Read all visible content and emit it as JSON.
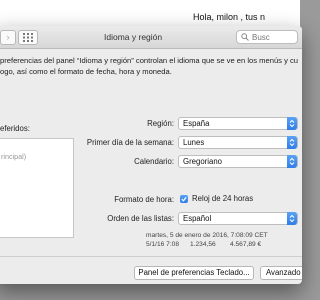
{
  "background": {
    "greeting": "Hola,  milon ,  tus n"
  },
  "window": {
    "title": "Idioma y región",
    "search_placeholder": "Busc"
  },
  "description": [
    "preferencias del panel “Idioma y región” controlan el idioma que se ve en los menús y cu",
    "ogo, así como el formato de fecha, hora y moneda."
  ],
  "languages": {
    "label": "eferidos:",
    "items": [
      "rincipal)"
    ]
  },
  "settings": {
    "region_label": "Región:",
    "region_value": "España",
    "first_day_label": "Primer día de la semana:",
    "first_day_value": "Lunes",
    "calendar_label": "Calendario:",
    "calendar_value": "Gregoriano",
    "time_format_label": "Formato de hora:",
    "time_format_checkbox_label": "Reloj de 24 horas",
    "sort_order_label": "Orden de las listas:",
    "sort_order_value": "Español"
  },
  "samples": {
    "line1": "martes, 5 de enero de 2016, 7:08:09 CET",
    "date_short": "5/1/16 7:08",
    "number": "1.234,56",
    "currency": "4.567,89 €"
  },
  "buttons": {
    "keyboard": "Panel de preferencias Teclado...",
    "advanced": "Avanzado"
  },
  "colors": {
    "accent": "#2f7ee8",
    "window_bg": "#ececec"
  }
}
